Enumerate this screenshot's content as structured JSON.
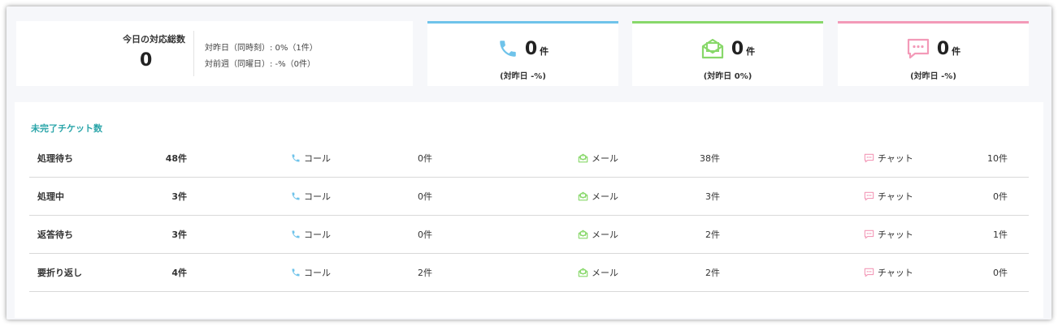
{
  "summary": {
    "total_label": "今日の対応総数",
    "total_value": "0",
    "compare_yesterday": "対昨日（同時刻）: 0%（1件）",
    "compare_last_week": "対前週（同曜日）: -%（0件）"
  },
  "channel_cards": [
    {
      "key": "call",
      "icon": "phone-icon",
      "count": "0",
      "unit": "件",
      "sub": "(対昨日 -%)",
      "color": "#6fc3ea"
    },
    {
      "key": "mail",
      "icon": "mail-open-icon",
      "count": "0",
      "unit": "件",
      "sub": "(対昨日 0%)",
      "color": "#88d86a"
    },
    {
      "key": "chat",
      "icon": "chat-bubble-icon",
      "count": "0",
      "unit": "件",
      "sub": "(対昨日 -%)",
      "color": "#f39ab8"
    }
  ],
  "pending": {
    "title": "未完了チケット数",
    "channel_labels": {
      "call": "コール",
      "mail": "メール",
      "chat": "チャット"
    },
    "rows": [
      {
        "label": "処理待ち",
        "total": "48件",
        "call": "0件",
        "mail": "38件",
        "chat": "10件"
      },
      {
        "label": "処理中",
        "total": "3件",
        "call": "0件",
        "mail": "3件",
        "chat": "0件"
      },
      {
        "label": "返答待ち",
        "total": "3件",
        "call": "0件",
        "mail": "2件",
        "chat": "1件"
      },
      {
        "label": "要折り返し",
        "total": "4件",
        "call": "2件",
        "mail": "2件",
        "chat": "0件"
      }
    ]
  }
}
